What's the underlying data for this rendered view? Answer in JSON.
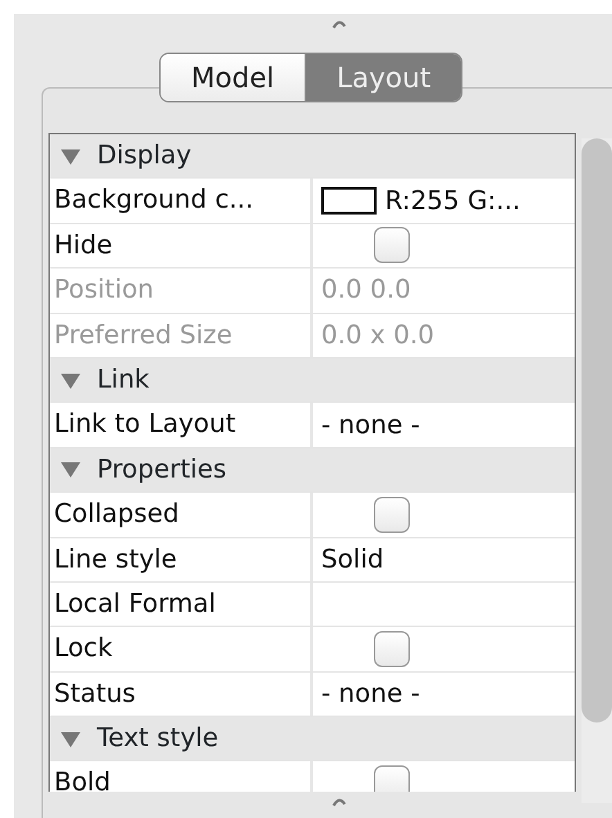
{
  "tabs": [
    {
      "label": "Model",
      "selected": false
    },
    {
      "label": "Layout",
      "selected": true
    }
  ],
  "sections": [
    {
      "title": "Display",
      "expanded": true,
      "rows": [
        {
          "label": "Background c...",
          "kind": "color",
          "value": "R:255 G:...",
          "color": "#ffffff",
          "disabled": false
        },
        {
          "label": "Hide",
          "kind": "checkbox",
          "checked": false,
          "disabled": false
        },
        {
          "label": "Position",
          "kind": "text",
          "value": "0.0 0.0",
          "disabled": true
        },
        {
          "label": "Preferred Size",
          "kind": "text",
          "value": "0.0 x 0.0",
          "disabled": true
        }
      ]
    },
    {
      "title": "Link",
      "expanded": true,
      "rows": [
        {
          "label": "Link to Layout",
          "kind": "text",
          "value": "- none -",
          "disabled": false
        }
      ]
    },
    {
      "title": "Properties",
      "expanded": true,
      "rows": [
        {
          "label": "Collapsed",
          "kind": "checkbox",
          "checked": false,
          "disabled": false
        },
        {
          "label": "Line style",
          "kind": "text",
          "value": "Solid",
          "disabled": false
        },
        {
          "label": "Local Formal",
          "kind": "empty",
          "disabled": false
        },
        {
          "label": "Lock",
          "kind": "checkbox",
          "checked": false,
          "disabled": false
        },
        {
          "label": "Status",
          "kind": "text",
          "value": "- none -",
          "disabled": false
        }
      ]
    },
    {
      "title": "Text style",
      "expanded": true,
      "rows": [
        {
          "label": "Bold",
          "kind": "checkbox",
          "checked": false,
          "disabled": false
        }
      ]
    }
  ]
}
